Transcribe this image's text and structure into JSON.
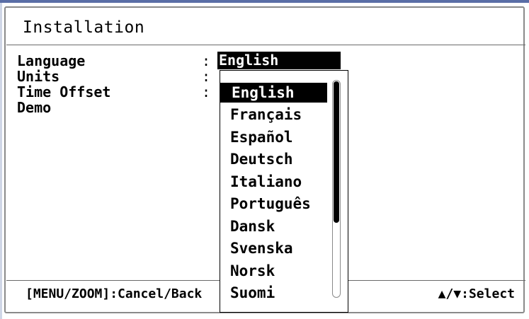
{
  "window": {
    "title": "Installation"
  },
  "menu": {
    "items": [
      {
        "label": "Language"
      },
      {
        "label": "Units"
      },
      {
        "label": "Time Offset"
      },
      {
        "label": "Demo"
      }
    ],
    "separator": ":",
    "language_value": "English"
  },
  "dropdown": {
    "selected": "English",
    "options": [
      "English",
      "Français",
      "Español",
      "Deutsch",
      "Italiano",
      "Português",
      "Dansk",
      "Svenska",
      "Norsk",
      "Suomi"
    ],
    "scroll_position": 0
  },
  "footer": {
    "left_hint": "[MENU/ZOOM]:Cancel/Back",
    "right_hint": "▲/▼:Select"
  },
  "colors": {
    "background": "#ffffff",
    "text": "#000000",
    "highlight_bg": "#000000",
    "highlight_text": "#ffffff",
    "accent_bar": "#5a6ea6"
  }
}
